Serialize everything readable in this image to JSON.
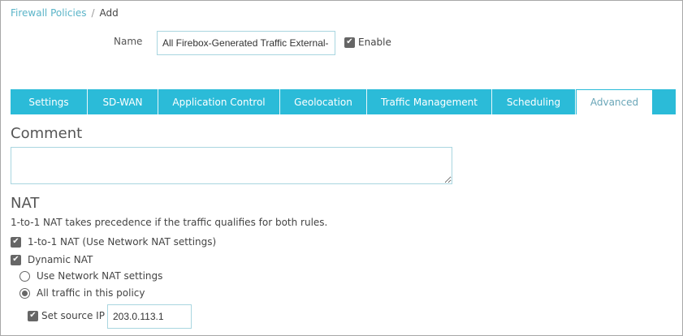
{
  "breadcrumb": {
    "parent": "Firewall Policies",
    "separator": "/",
    "current": "Add"
  },
  "name_field": {
    "label": "Name",
    "value": "All Firebox-Generated Traffic External-"
  },
  "enable": {
    "label": "Enable",
    "checked": true
  },
  "tabs": [
    {
      "label": "Settings"
    },
    {
      "label": "SD-WAN"
    },
    {
      "label": "Application Control"
    },
    {
      "label": "Geolocation"
    },
    {
      "label": "Traffic Management"
    },
    {
      "label": "Scheduling"
    },
    {
      "label": "Advanced",
      "active": true
    }
  ],
  "comment": {
    "heading": "Comment",
    "value": ""
  },
  "nat": {
    "heading": "NAT",
    "note": "1-to-1 NAT takes precedence if the traffic qualifies for both rules.",
    "one_to_one": {
      "label": "1-to-1 NAT (Use Network NAT settings)",
      "checked": true
    },
    "dynamic": {
      "label": "Dynamic NAT",
      "checked": true
    },
    "use_network": {
      "label": "Use Network NAT settings",
      "selected": false
    },
    "all_traffic": {
      "label": "All traffic in this policy",
      "selected": true
    },
    "set_source_ip": {
      "label": "Set source IP",
      "checked": true,
      "value": "203.0.113.1"
    }
  },
  "colors": {
    "accent": "#2bbbd8",
    "link": "#5ab4c8"
  }
}
